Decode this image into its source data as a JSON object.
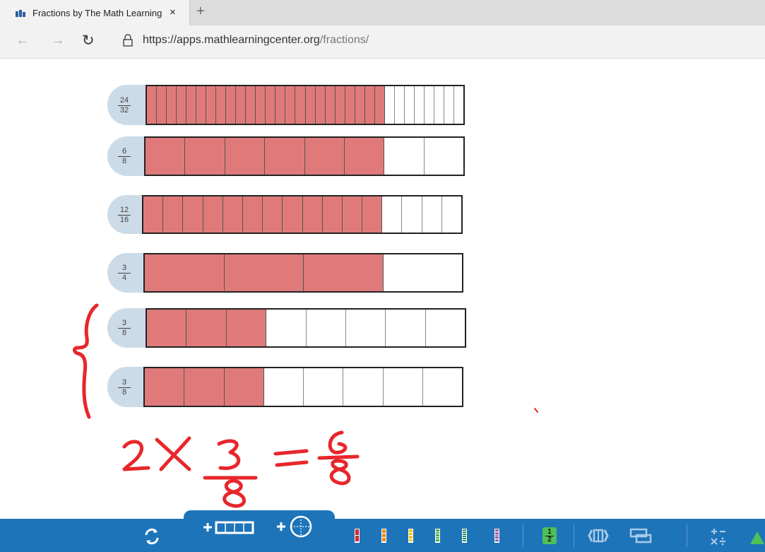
{
  "browser": {
    "tab_title": "Fractions by The Math Learning",
    "tab_close": "×",
    "new_tab": "+",
    "url_host": "https://apps.mathlearningcenter.org",
    "url_path": "/fractions/"
  },
  "fraction_bars": [
    {
      "numerator": "24",
      "denominator": "32",
      "parts": 32,
      "filled": 24
    },
    {
      "numerator": "6",
      "denominator": "8",
      "parts": 8,
      "filled": 6
    },
    {
      "numerator": "12",
      "denominator": "16",
      "parts": 16,
      "filled": 12
    },
    {
      "numerator": "3",
      "denominator": "4",
      "parts": 4,
      "filled": 3
    },
    {
      "numerator": "3",
      "denominator": "8",
      "parts": 8,
      "filled": 3
    },
    {
      "numerator": "3",
      "denominator": "8",
      "parts": 8,
      "filled": 3
    }
  ],
  "annotation": {
    "equation_lhs": "2×",
    "fraction_num": "3",
    "fraction_den": "8",
    "equals": "=",
    "result_num": "6",
    "result_den": "8",
    "ink_color": "#e8262b"
  },
  "toolbar": {
    "half_badge_num": "1",
    "half_badge_den": "2",
    "strip_colors": [
      "#d9262c",
      "#f08a1c",
      "#f0c419",
      "#4cae4c",
      "#2f8f5a",
      "#8a3b8e"
    ],
    "operations_label": "+−\n×÷"
  },
  "colors": {
    "fill": "#e07a7a",
    "tab": "#cbdbe7",
    "toolbar": "#1e74b9"
  }
}
